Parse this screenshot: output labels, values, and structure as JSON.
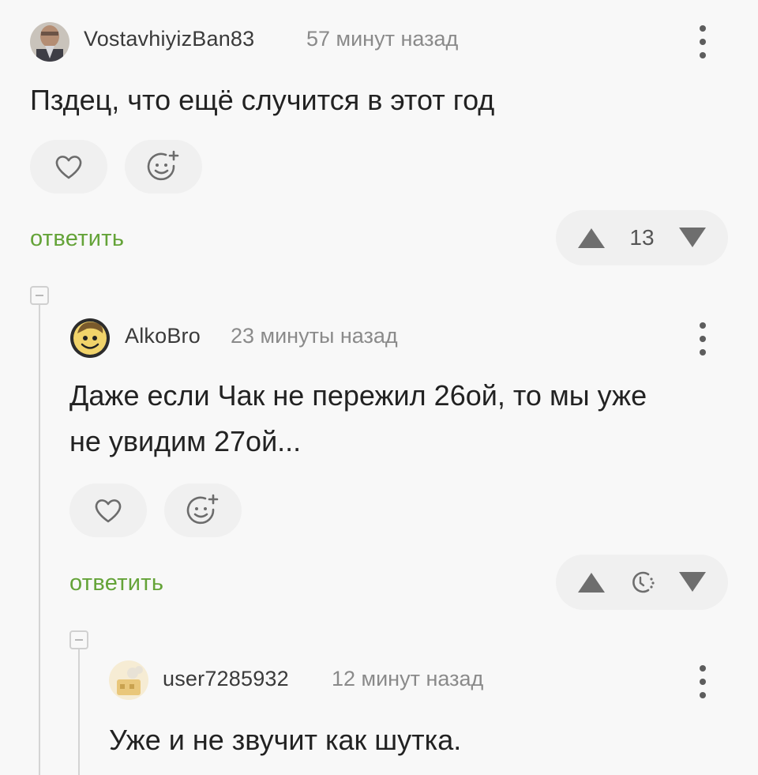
{
  "comments": [
    {
      "username": "VostavhiyizBan83",
      "time": "57 минут назад",
      "text": "Пздец, что ещё случится в этот год",
      "reply_label": "ответить",
      "rating": "13"
    },
    {
      "username": "AlkoBro",
      "time": "23 минуты назад",
      "text_line1": "Даже если Чак не пережил 26ой, то мы уже",
      "text_line2": "не увидим 27ой...",
      "reply_label": "ответить",
      "rating_icon": "clock-icon"
    },
    {
      "username": "user7285932",
      "time": "12 минут назад",
      "text": "Уже и не звучит как шутка."
    }
  ],
  "colors": {
    "background": "#f8f8f8",
    "reply_link": "#64a338",
    "button_bg": "#f0f0f0",
    "icon": "#6c6c6c"
  }
}
